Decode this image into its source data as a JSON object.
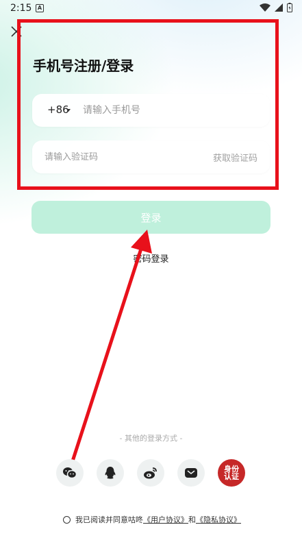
{
  "status_bar": {
    "time": "2:15",
    "a_icon_letter": "A"
  },
  "title": "手机号注册/登录",
  "phone_field": {
    "country_code": "+86",
    "placeholder": "请输入手机号"
  },
  "code_field": {
    "placeholder": "请输入验证码",
    "get_code_label": "获取验证码"
  },
  "login_button": "登录",
  "password_login": "密码登录",
  "other_methods_label": "- 其他的登录方式 -",
  "identity_badge": "身份认证",
  "agreement": {
    "prefix": "我已阅读并同意咕咚",
    "user_agreement": "《用户协议》",
    "and": "和",
    "privacy_policy": "《隐私协议》"
  },
  "colors": {
    "highlight": "#e8111b",
    "accent_light": "#bff0dc",
    "id_badge": "#c62828"
  },
  "social_icons": [
    "wechat-icon",
    "qq-icon",
    "weibo-icon",
    "mail-icon",
    "id-auth-icon"
  ]
}
